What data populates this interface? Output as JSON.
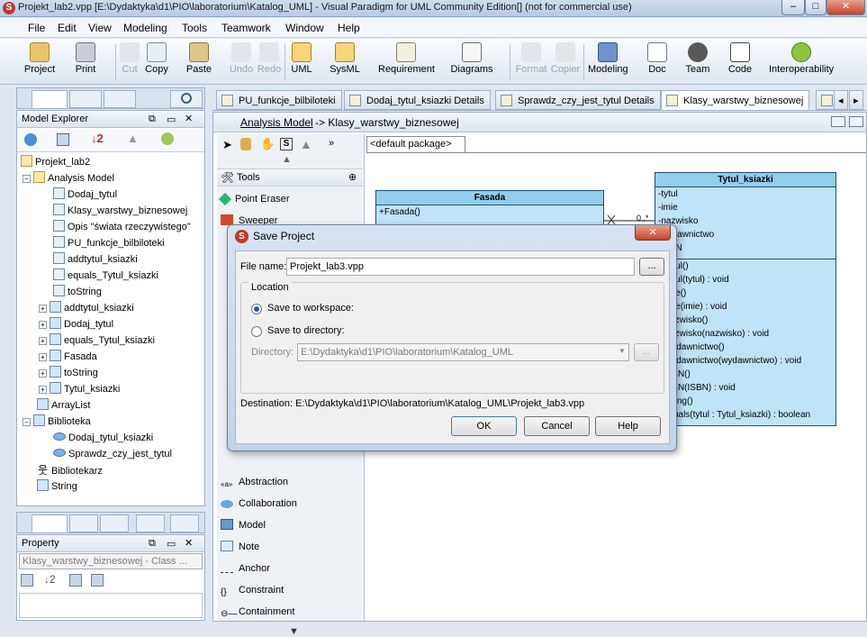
{
  "window": {
    "title": "Projekt_lab2.vpp [E:\\Dydaktyka\\d1\\PIO\\laboratorium\\Katalog_UML] - Visual Paradigm for UML Community Edition[] (not for commercial use)",
    "minimize": "–",
    "maximize": "□",
    "close": "✕"
  },
  "menu": [
    "File",
    "Edit",
    "View",
    "Modeling",
    "Tools",
    "Teamwork",
    "Window",
    "Help"
  ],
  "toolbar": {
    "project": "Project",
    "print": "Print",
    "cut": "Cut",
    "copy": "Copy",
    "paste": "Paste",
    "undo": "Undo",
    "redo": "Redo",
    "uml": "UML",
    "sysml": "SysML",
    "requirement": "Requirement",
    "diagrams": "Diagrams",
    "format": "Format",
    "copier": "Copier",
    "modeling": "Modeling",
    "doc": "Doc",
    "team": "Team",
    "code": "Code",
    "interoperability": "Interoperability"
  },
  "model_explorer": {
    "title": "Model Explorer",
    "items": [
      "Projekt_lab2",
      "Analysis Model",
      "Dodaj_tytul",
      "Klasy_warstwy_biznesowej",
      "Opis \"świata rzeczywistego\"",
      "PU_funkcje_bilbiloteki",
      "addtytul_ksiazki",
      "equals_Tytul_ksiazki",
      "toString",
      "addtytul_ksiazki",
      "Dodaj_tytul",
      "equals_Tytul_ksiazki",
      "Fasada",
      "toString",
      "Tytul_ksiazki",
      "ArrayList",
      "Biblioteka",
      "Dodaj_tytul_ksiazki",
      "Sprawdz_czy_jest_tytul",
      "Bibliotekarz",
      "String"
    ]
  },
  "property": {
    "title": "Property",
    "selector": "Klasy_warstwy_biznesowej - Class ..."
  },
  "tabs": [
    "PU_funkcje_bilbiloteki",
    "Dodaj_tytul_ksiazki Details",
    "Sprawdz_czy_jest_tytul Details",
    "Klasy_warstwy_biznesowej"
  ],
  "breadcrumb": {
    "link": "Analysis Model",
    "rest": " -> Klasy_warstwy_biznesowej"
  },
  "package_tab": "<default package>",
  "palette": {
    "tools_header": "Tools",
    "items": [
      "Point Eraser",
      "Sweeper",
      "Abstraction",
      "Collaboration",
      "Model",
      "Note",
      "Anchor",
      "Constraint",
      "Containment"
    ]
  },
  "diagram": {
    "fasada": {
      "name": "Fasada",
      "ops": [
        "+Fasada()"
      ]
    },
    "tytul": {
      "name": "Tytul_ksiazki",
      "attrs": [
        "-tytul",
        "-imie",
        "-nazwisko",
        "-wydawnictwo",
        "-ISBN"
      ],
      "ops": [
        "+Tytul()",
        "+Tytul(tytul) : void",
        "+Imie()",
        "+Imie(imie) : void",
        "+Nazwisko()",
        "+Nazwisko(nazwisko) : void",
        "+Wydawnictwo()",
        "+Wydawnictwo(wydawnictwo) : void",
        "+ISBN()",
        "+ISBN(ISBN) : void",
        "+String()",
        "+equals(tytul : Tytul_ksiazki) : boolean"
      ]
    },
    "multiplicity": "0..*"
  },
  "dialog": {
    "title": "Save Project",
    "file_name_label": "File name:",
    "file_name_value": "Projekt_lab3.vpp",
    "browse": "...",
    "location_label": "Location",
    "workspace": "Save to workspace:",
    "directory": "Save to directory:",
    "directory_label": "Directory:",
    "directory_value": "E:\\Dydaktyka\\d1\\PIO\\laboratorium\\Katalog_UML",
    "destination": "Destination: E:\\Dydaktyka\\d1\\PIO\\laboratorium\\Katalog_UML\\Projekt_lab3.vpp",
    "ok": "OK",
    "cancel": "Cancel",
    "help": "Help"
  }
}
